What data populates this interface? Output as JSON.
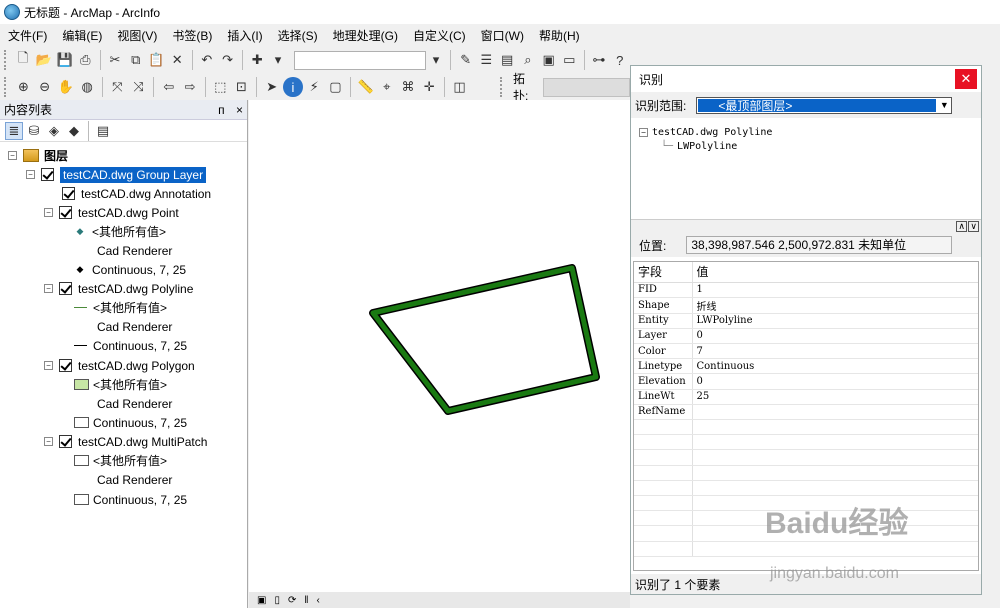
{
  "window": {
    "title": "无标题 - ArcMap - ArcInfo"
  },
  "menu": [
    "文件(F)",
    "编辑(E)",
    "视图(V)",
    "书签(B)",
    "插入(I)",
    "选择(S)",
    "地理处理(G)",
    "自定义(C)",
    "窗口(W)",
    "帮助(H)"
  ],
  "toolbar": {
    "snap_label": "拓扑:"
  },
  "toc": {
    "title": "内容列表",
    "pin": "ᴨ",
    "close": "×",
    "root": "图层",
    "group": "testCAD.dwg Group Layer",
    "layers": [
      {
        "name": "testCAD.dwg Annotation"
      },
      {
        "name": "testCAD.dwg Point",
        "others": "<其他所有值>",
        "renderer": "Cad Renderer",
        "continuous": "Continuous, 7, 25"
      },
      {
        "name": "testCAD.dwg Polyline",
        "others": "<其他所有值>",
        "renderer": "Cad Renderer",
        "continuous": "Continuous, 7, 25"
      },
      {
        "name": "testCAD.dwg Polygon",
        "others": "<其他所有值>",
        "renderer": "Cad Renderer",
        "continuous": "Continuous, 7, 25"
      },
      {
        "name": "testCAD.dwg MultiPatch",
        "others": "<其他所有值>",
        "renderer": "Cad Renderer",
        "continuous": "Continuous, 7, 25"
      }
    ]
  },
  "map": {
    "feature_color": "#1a7a12",
    "outline_color": "#000000"
  },
  "identify": {
    "title": "识别",
    "scope_label": "识别范围:",
    "scope_value": "<最顶部图层>",
    "tree_root": "testCAD.dwg Polyline",
    "tree_child": "LWPolyline",
    "location_label": "位置:",
    "location_value": "38,398,987.546  2,500,972.831 未知单位",
    "col_field": "字段",
    "col_value": "值",
    "rows": [
      {
        "field": "FID",
        "value": "1"
      },
      {
        "field": "Shape",
        "value": "折线"
      },
      {
        "field": "Entity",
        "value": "LWPolyline"
      },
      {
        "field": "Layer",
        "value": "0"
      },
      {
        "field": "Color",
        "value": "7"
      },
      {
        "field": "Linetype",
        "value": "Continuous"
      },
      {
        "field": "Elevation",
        "value": "0"
      },
      {
        "field": "LineWt",
        "value": "25"
      },
      {
        "field": "RefName",
        "value": ""
      }
    ],
    "footer": "识别了 1 个要素"
  },
  "watermark": {
    "line1": "Baidu经验",
    "line2": "jingyan.baidu.com"
  }
}
